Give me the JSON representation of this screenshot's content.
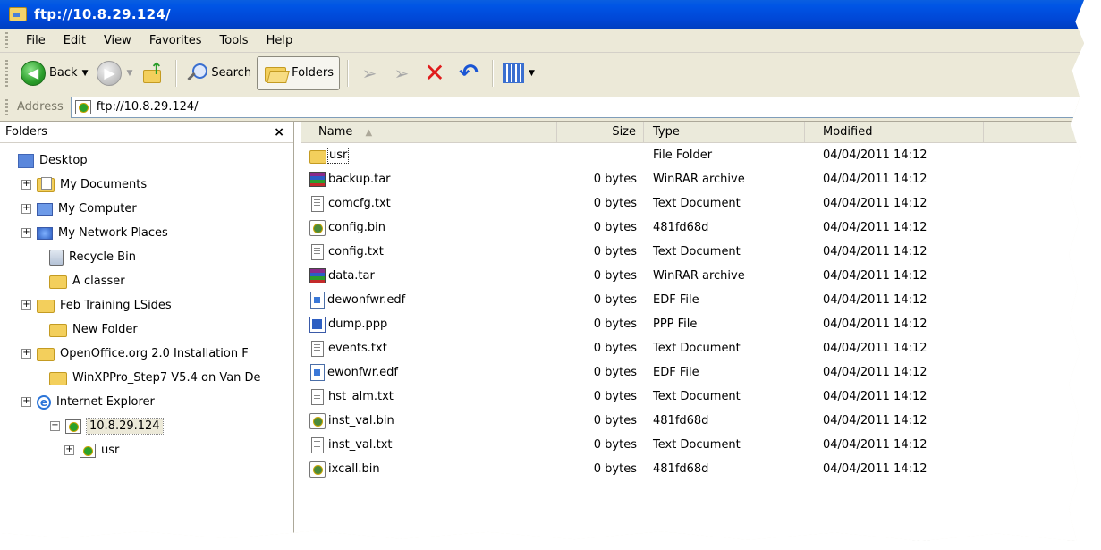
{
  "window": {
    "title": "ftp://10.8.29.124/"
  },
  "menu": [
    "File",
    "Edit",
    "View",
    "Favorites",
    "Tools",
    "Help"
  ],
  "toolbar": {
    "back_label": "Back",
    "search_label": "Search",
    "folders_label": "Folders"
  },
  "address": {
    "label": "Address",
    "value": "ftp://10.8.29.124/"
  },
  "folders_pane": {
    "title": "Folders",
    "close": "×",
    "items": [
      {
        "label": "Desktop",
        "icon": "desktop-icon",
        "expander": ""
      },
      {
        "label": "My Documents",
        "icon": "my-documents-icon",
        "expander": "+"
      },
      {
        "label": "My Computer",
        "icon": "my-computer-icon",
        "expander": "+"
      },
      {
        "label": "My Network Places",
        "icon": "network-places-icon",
        "expander": "+"
      },
      {
        "label": "Recycle Bin",
        "icon": "recycle-bin-icon",
        "expander": ""
      },
      {
        "label": "A classer",
        "icon": "folder-icon",
        "expander": ""
      },
      {
        "label": "Feb Training LSides",
        "icon": "folder-icon",
        "expander": "+"
      },
      {
        "label": "New Folder",
        "icon": "folder-icon",
        "expander": ""
      },
      {
        "label": "OpenOffice.org 2.0 Installation F",
        "icon": "folder-icon",
        "expander": "+"
      },
      {
        "label": "WinXPPro_Step7 V5.4 on Van De",
        "icon": "folder-icon",
        "expander": ""
      },
      {
        "label": "Internet Explorer",
        "icon": "internet-explorer-icon",
        "expander": "+"
      },
      {
        "label": "10.8.29.124",
        "icon": "ftp-site-icon",
        "expander": "−"
      },
      {
        "label": "usr",
        "icon": "ftp-site-icon",
        "expander": "+"
      }
    ]
  },
  "file_list": {
    "columns": {
      "name": "Name",
      "size": "Size",
      "type": "Type",
      "modified": "Modified"
    },
    "rows": [
      {
        "name": "usr",
        "size": "",
        "type": "File Folder",
        "modified": "04/04/2011 14:12",
        "icon": "folder-icon"
      },
      {
        "name": "backup.tar",
        "size": "0 bytes",
        "type": "WinRAR archive",
        "modified": "04/04/2011 14:12",
        "icon": "winrar-icon"
      },
      {
        "name": "comcfg.txt",
        "size": "0 bytes",
        "type": "Text Document",
        "modified": "04/04/2011 14:12",
        "icon": "text-file-icon"
      },
      {
        "name": "config.bin",
        "size": "0 bytes",
        "type": "481fd68d",
        "modified": "04/04/2011 14:12",
        "icon": "bin-file-icon"
      },
      {
        "name": "config.txt",
        "size": "0 bytes",
        "type": "Text Document",
        "modified": "04/04/2011 14:12",
        "icon": "text-file-icon"
      },
      {
        "name": "data.tar",
        "size": "0 bytes",
        "type": "WinRAR archive",
        "modified": "04/04/2011 14:12",
        "icon": "winrar-icon"
      },
      {
        "name": "dewonfwr.edf",
        "size": "0 bytes",
        "type": "EDF File",
        "modified": "04/04/2011 14:12",
        "icon": "edf-file-icon"
      },
      {
        "name": "dump.ppp",
        "size": "0 bytes",
        "type": "PPP File",
        "modified": "04/04/2011 14:12",
        "icon": "ppp-file-icon"
      },
      {
        "name": "events.txt",
        "size": "0 bytes",
        "type": "Text Document",
        "modified": "04/04/2011 14:12",
        "icon": "text-file-icon"
      },
      {
        "name": "ewonfwr.edf",
        "size": "0 bytes",
        "type": "EDF File",
        "modified": "04/04/2011 14:12",
        "icon": "edf-file-icon"
      },
      {
        "name": "hst_alm.txt",
        "size": "0 bytes",
        "type": "Text Document",
        "modified": "04/04/2011 14:12",
        "icon": "text-file-icon"
      },
      {
        "name": "inst_val.bin",
        "size": "0 bytes",
        "type": "481fd68d",
        "modified": "04/04/2011 14:12",
        "icon": "bin-file-icon"
      },
      {
        "name": "inst_val.txt",
        "size": "0 bytes",
        "type": "Text Document",
        "modified": "04/04/2011 14:12",
        "icon": "text-file-icon"
      },
      {
        "name": "ixcall.bin",
        "size": "0 bytes",
        "type": "481fd68d",
        "modified": "04/04/2011 14:12",
        "icon": "bin-file-icon"
      }
    ]
  }
}
